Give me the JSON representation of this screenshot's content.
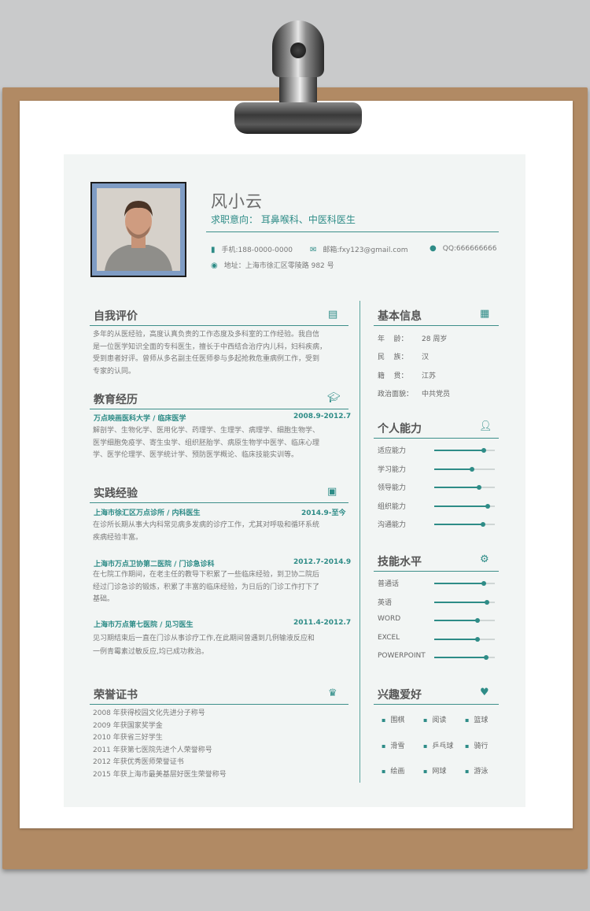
{
  "profile": {
    "name": "风小云",
    "intent_label": "求职意向：",
    "intent_value": "耳鼻喉科、中医科医生",
    "phone": "手机:188-0000-0000",
    "email": "邮箱:fxy123@gmail.com",
    "qq": "QQ:666666666",
    "address": "地址：上海市徐汇区零陵路 982 号"
  },
  "self_eval": {
    "title": "自我评价",
    "lines": [
      "多年的从医经验，高度认真负责的工作态度及多科室的工作经验。我自信",
      "是一位医学知识全面的专科医生，擅长于中西结合治疗内儿科，妇科疾病，",
      "受到患者好评。曾师从多名副主任医师参与多起抢救危重病例工作，受到",
      "专家的认同。"
    ]
  },
  "education": {
    "title": "教育经历",
    "school": "万点映画医科大学  /  临床医学",
    "date": "2008.9-2012.7",
    "lines": [
      "解剖学、生物化学、医用化学、药理学、生理学、病理学、细胞生物学、",
      "医学细胞免疫学、寄生虫学、组织胚胎学、病原生物学中医学、临床心理",
      "学、医学伦理学、医学统计学、预防医学概论、临床技能实训等。"
    ]
  },
  "practice": {
    "title": "实践经验",
    "items": [
      {
        "head": "上海市徐汇区万点诊所  /  内科医生",
        "date": "2014.9-至今",
        "lines": [
          "在诊所长期从事大内科常见病多发病的诊疗工作，尤其对呼吸和循环系统",
          "疾病经验丰富。"
        ]
      },
      {
        "head": "上海市万点卫协第二医院  /  门诊急诊科",
        "date": "2012.7-2014.9",
        "lines": [
          "在七院工作期间，在老主任的教导下积累了一些临床经验，到卫协二院后",
          "经过门诊急诊的锻炼，积累了丰富的临床经验，为日后的门诊工作打下了",
          "基础。"
        ]
      },
      {
        "head": "上海市万点第七医院  /  见习医生",
        "date": "2011.4-2012.7",
        "lines": [
          "见习期结束后一直在门诊从事诊疗工作,在此期间曾遇到几例输液反应和",
          "一例青霉素过敏反应,均已成功救治。"
        ]
      }
    ]
  },
  "honors": {
    "title": "荣誉证书",
    "items": [
      "2008 年获得校园文化先进分子称号",
      "2009 年获国家奖学金",
      "2010 年获省三好学生",
      "2011 年获第七医院先进个人荣誉称号",
      "2012 年获优秀医师荣誉证书",
      "2015 年获上海市最美基层好医生荣誉称号"
    ]
  },
  "basic": {
    "title": "基本信息",
    "rows": [
      {
        "label": "年    龄：",
        "value": "28 周岁"
      },
      {
        "label": "民    族：",
        "value": "汉"
      },
      {
        "label": "籍    贯：",
        "value": "江苏"
      },
      {
        "label": "政治面貌：",
        "value": "中共党员"
      }
    ]
  },
  "ability": {
    "title": "个人能力",
    "items": [
      {
        "label": "适应能力",
        "level": 0.82
      },
      {
        "label": "学习能力",
        "level": 0.62
      },
      {
        "label": "领导能力",
        "level": 0.74
      },
      {
        "label": "组织能力",
        "level": 0.88
      },
      {
        "label": "沟通能力",
        "level": 0.8
      }
    ]
  },
  "skills": {
    "title": "技能水平",
    "items": [
      {
        "label": "普通话",
        "level": 0.82
      },
      {
        "label": "英语",
        "level": 0.87
      },
      {
        "label": "WORD",
        "level": 0.71
      },
      {
        "label": "EXCEL",
        "level": 0.72
      },
      {
        "label": "POWERPOINT",
        "level": 0.86
      }
    ]
  },
  "hobbies": {
    "title": "兴趣爱好",
    "items": [
      "围棋",
      "阅读",
      "篮球",
      "滑雪",
      "乒乓球",
      "骑行",
      "绘画",
      "网球",
      "游泳"
    ]
  },
  "colors": {
    "accent": "#2e8c87",
    "sheet": "#f2f5f4",
    "board": "#b18a64"
  },
  "icons": [
    "phone-icon",
    "mail-icon",
    "qq-icon",
    "location-icon",
    "comment-icon",
    "graduation-cap-icon",
    "briefcase-icon",
    "trophy-icon",
    "contact-card-icon",
    "add-user-icon",
    "gear-icon",
    "heart-icon"
  ]
}
